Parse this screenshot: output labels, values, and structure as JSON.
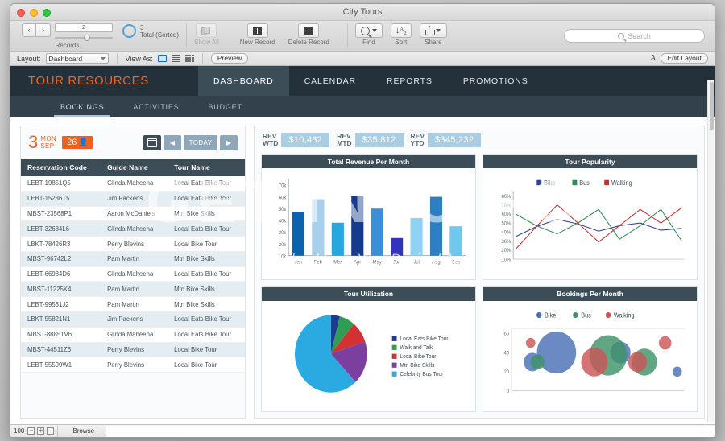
{
  "window": {
    "title": "City Tours",
    "traffic_lights": [
      "close",
      "minimize",
      "zoom"
    ]
  },
  "toolbar": {
    "nav_prev": "‹",
    "nav_next": "›",
    "record_slider_value": "2",
    "records_label": "Records",
    "record_total": "3",
    "record_total_sub": "Total (Sorted)",
    "show_all_label": "Show All",
    "new_record_label": "New Record",
    "delete_record_label": "Delete Record",
    "find_label": "Find",
    "sort_label": "Sort",
    "share_label": "Share",
    "search_placeholder": "Search"
  },
  "layoutbar": {
    "layout_label": "Layout:",
    "layout_value": "Dashboard",
    "view_as_label": "View As:",
    "preview_label": "Preview",
    "font_icon_label": "A",
    "edit_layout_label": "Edit Layout"
  },
  "nav": {
    "brand": "TOUR RESOURCES",
    "tabs": [
      {
        "label": "DASHBOARD",
        "active": true
      },
      {
        "label": "CALENDAR",
        "active": false
      },
      {
        "label": "REPORTS",
        "active": false
      },
      {
        "label": "PROMOTIONS",
        "active": false
      }
    ],
    "subtabs": [
      {
        "label": "BOOKINGS",
        "active": true
      },
      {
        "label": "ACTIVITIES",
        "active": false
      },
      {
        "label": "BUDGET",
        "active": false
      }
    ]
  },
  "left_panel": {
    "date_day": "3",
    "date_weekday": "MON",
    "date_month": "SEP",
    "people_count": "26",
    "today_label": "TODAY",
    "prev_label": "◀",
    "next_label": "▶",
    "columns": [
      "Reservation Code",
      "Guide Name",
      "Tour Name"
    ],
    "rows": [
      [
        "LEBT-19851Q5",
        "Glinda Maheena",
        "Local Eats Bike Tour"
      ],
      [
        "LEBT-15236T5",
        "Jim Packens",
        "Local Eats Bike Tour"
      ],
      [
        "MBST-23568P1",
        "Aaron McDaniels",
        "Mtn Bike Skills"
      ],
      [
        "LEBT-32684L6",
        "Glinda Maheena",
        "Local Eats Bike Tour"
      ],
      [
        "LBKT-78426R3",
        "Perry Blevins",
        "Local Bike Tour"
      ],
      [
        "MBST-96742L2",
        "Pam Martin",
        "Mtn Bike Skills"
      ],
      [
        "LEBT-66984D6",
        "Glinda Maheena",
        "Local Eats Bike Tour"
      ],
      [
        "MBST-11225K4",
        "Pam Martin",
        "Mtn Bike Skills"
      ],
      [
        "LEBT-99531J2",
        "Pam Martin",
        "Mtn Bike Skills"
      ],
      [
        "LBKT-55821N1",
        "Jim Packens",
        "Local Eats Bike Tour"
      ],
      [
        "MBST-88851V6",
        "Glinda Maheena",
        "Local Eats Bike Tour"
      ],
      [
        "MBST-44511Z6",
        "Perry Blevins",
        "Local Bike Tour"
      ],
      [
        "LEBT-55599W1",
        "Perry Blevins",
        "Local Bike Tour"
      ]
    ]
  },
  "kpis": [
    {
      "label_line1": "REV",
      "label_line2": "WTD",
      "value": "$10,432"
    },
    {
      "label_line1": "REV",
      "label_line2": "MTD",
      "value": "$35,812"
    },
    {
      "label_line1": "REV",
      "label_line2": "YTD",
      "value": "$345,232"
    }
  ],
  "statusbar": {
    "zoom_level": "100",
    "zoom_out": "−",
    "zoom_in": "＋",
    "mode": "Browse"
  },
  "watermark": {
    "big": "GET INTO PC",
    "small": "Download Free Your Desired App"
  },
  "chart_data": [
    {
      "id": "total_revenue_per_month",
      "type": "bar",
      "title": "Total Revenue Per Month",
      "categories": [
        "Jan",
        "Feb",
        "Mar",
        "Apr",
        "May",
        "Jun",
        "Jul",
        "Aug",
        "Sep"
      ],
      "values": [
        47,
        58,
        38,
        61,
        50,
        25,
        42,
        60,
        35
      ],
      "bar_colors": [
        "#0b62ad",
        "#a8d0ec",
        "#25a7e0",
        "#163a8c",
        "#3b8fd4",
        "#3333bb",
        "#8fd3f4",
        "#2e7fc1",
        "#6fc8ed"
      ],
      "ytick_labels": [
        "70k",
        "60k",
        "50k",
        "40k",
        "30k",
        "20k",
        "10k"
      ],
      "ytick_values": [
        70,
        60,
        50,
        40,
        30,
        20,
        10
      ],
      "ylim": [
        10,
        75
      ],
      "xlabel": "",
      "ylabel": "",
      "grid": false,
      "legend": "none"
    },
    {
      "id": "tour_popularity",
      "type": "line",
      "title": "Tour Popularity",
      "x": [
        "1",
        "2",
        "3",
        "4",
        "5",
        "6",
        "7",
        "8",
        "9"
      ],
      "series": [
        {
          "name": "Bike",
          "color": "#2b3f9e",
          "values": [
            35,
            46,
            54,
            49,
            41,
            47,
            50,
            42,
            44
          ]
        },
        {
          "name": "Bus",
          "color": "#2e8b57",
          "values": [
            60,
            47,
            38,
            50,
            65,
            32,
            47,
            65,
            30
          ]
        },
        {
          "name": "Walking",
          "color": "#cc2e2e",
          "values": [
            21,
            46,
            70,
            50,
            29,
            47,
            65,
            50,
            67
          ]
        }
      ],
      "ytick_labels": [
        "80%",
        "70%",
        "60%",
        "50%",
        "40%",
        "30%",
        "20%",
        "10%"
      ],
      "ytick_values": [
        80,
        70,
        60,
        50,
        40,
        30,
        20,
        10
      ],
      "ylim": [
        10,
        85
      ],
      "legend_position": "top",
      "grid": false
    },
    {
      "id": "tour_utilization",
      "type": "pie",
      "title": "Tour Utilization",
      "labels": [
        "Local Eats Bike Tour",
        "Walk and Talk",
        "Local Bike Tour",
        "Mtn Bike Skills",
        "Celebrity Bus Tour"
      ],
      "values": [
        4,
        7,
        9,
        18,
        62
      ],
      "colors": [
        "#1f3a93",
        "#2e9e52",
        "#d33232",
        "#7b3fa0",
        "#2aaae0"
      ],
      "legend_position": "right"
    },
    {
      "id": "bookings_per_month",
      "type": "scatter",
      "title": "Bookings Per Month",
      "series": [
        {
          "name": "Bike",
          "color": "#4a6fb5",
          "points": [
            {
              "x": 12,
              "y": 30,
              "r": 11
            },
            {
              "x": 26,
              "y": 40,
              "r": 25
            },
            {
              "x": 63,
              "y": 40,
              "r": 13
            },
            {
              "x": 96,
              "y": 20,
              "r": 6
            }
          ]
        },
        {
          "name": "Bus",
          "color": "#3f9268",
          "points": [
            {
              "x": 15,
              "y": 30,
              "r": 9
            },
            {
              "x": 56,
              "y": 37,
              "r": 24
            },
            {
              "x": 77,
              "y": 30,
              "r": 16
            }
          ]
        },
        {
          "name": "Walking",
          "color": "#cb5555",
          "points": [
            {
              "x": 11,
              "y": 50,
              "r": 6
            },
            {
              "x": 48,
              "y": 30,
              "r": 17
            },
            {
              "x": 73,
              "y": 30,
              "r": 12
            },
            {
              "x": 89,
              "y": 50,
              "r": 8
            }
          ]
        }
      ],
      "ytick_labels": [
        "60",
        "40",
        "20",
        "0"
      ],
      "ytick_values": [
        60,
        40,
        20,
        0
      ],
      "ylim": [
        0,
        65
      ],
      "legend_position": "top",
      "grid": false
    }
  ]
}
